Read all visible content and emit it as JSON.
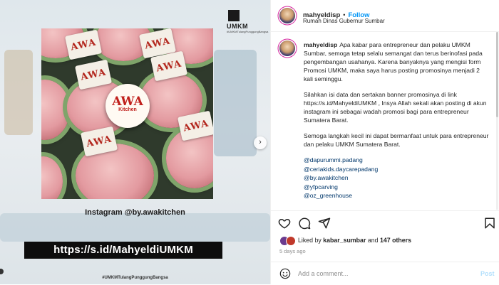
{
  "media": {
    "logo_text": "UMKM",
    "logo_sub": "#UMKMTulangPunggungBangsa",
    "brand_badge_line1": "AWA",
    "brand_badge_line2": "Kitchen",
    "flag_text": "AWA",
    "instagram_caption": "Instagram @by.awakitchen",
    "link_banner": "https://s.id/MahyeldiUMKM",
    "hashtag": "#UMKMTulangPunggungBangsa",
    "next_icon": "chevron-right-icon"
  },
  "header": {
    "username": "mahyeldisp",
    "separator": "•",
    "follow_label": "Follow",
    "location": "Rumah Dinas Gubernur Sumbar"
  },
  "caption": {
    "username": "mahyeldisp",
    "paragraph_1": "Apa kabar para entrepreneur dan pelaku UMKM Sumbar, semoga tetap selalu semangat dan terus berinofasi pada pengembangan usahanya. Karena banyaknya yang mengisi form Promosi UMKM, maka saya harus posting promosinya menjadi 2 kali seminggu.",
    "paragraph_2": "Silahkan isi data dan sertakan banner promosinya di link https://s.id/MahyeldiUMKM , Insya Allah sekali akan posting di akun instagram ini sebagai wadah promosi bagi para entrepreneur Sumatera Barat.",
    "paragraph_3": "Semoga langkah kecil ini dapat bermanfaat untuk para entrepreneur dan pelaku UMKM Sumatera Barat.",
    "mentions": [
      "@dapurummi.padang",
      "@ceriakids.daycarepadang",
      "@by.awakitchen",
      "@yfpcarving",
      "@oz_greenhouse"
    ]
  },
  "actions": {
    "like_icon": "heart-icon",
    "comment_icon": "comment-icon",
    "share_icon": "paper-plane-icon",
    "save_icon": "bookmark-icon"
  },
  "likes": {
    "prefix": "Liked by",
    "user": "kabar_sumbar",
    "conjunction": "and",
    "others": "147 others"
  },
  "timestamp": "5 days ago",
  "comment_box": {
    "emoji_icon": "smiley-icon",
    "placeholder": "Add a comment...",
    "post_label": "Post"
  },
  "colors": {
    "accent": "#0095f6",
    "mention": "#00376b",
    "muted": "#8e8e8e"
  }
}
